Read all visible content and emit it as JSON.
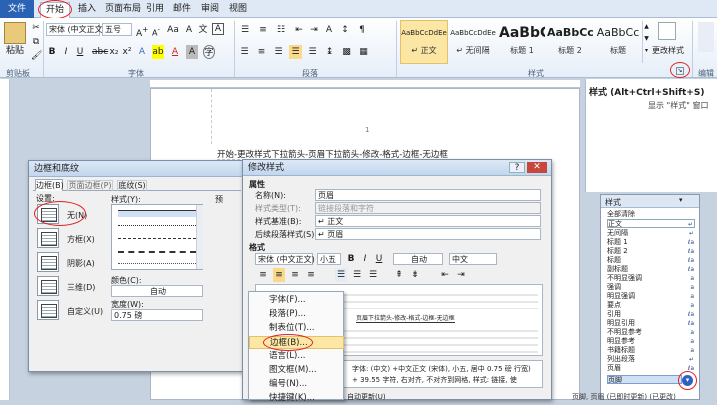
{
  "ribbon": {
    "tabs": [
      "文件",
      "开始",
      "插入",
      "页面布局",
      "引用",
      "邮件",
      "审阅",
      "视图"
    ],
    "clipboard": {
      "paste_label": "粘贴",
      "group_label": "剪贴板"
    },
    "font": {
      "font_name": "宋体 (中文正文)",
      "font_size": "五号",
      "group_label": "字体"
    },
    "paragraph": {
      "group_label": "段落"
    },
    "styles": {
      "items": [
        {
          "preview": "AaBbCcDdEe",
          "name": "↵ 正文"
        },
        {
          "preview": "AaBbCcDdEe",
          "name": "↵ 无间隔"
        },
        {
          "preview": "AaBbC",
          "name": "标题 1"
        },
        {
          "preview": "AaBbCc",
          "name": "标题 2"
        },
        {
          "preview": "AaBbCc",
          "name": "标题"
        }
      ],
      "change_styles_label": "更改样式",
      "group_label": "样式",
      "edit_label": "编辑"
    }
  },
  "document": {
    "page_number": "1",
    "body_text": "开始-更改样式下拉箭头-页眉下拉箭头-修改-格式-边框-无边框"
  },
  "border_dialog": {
    "title": "边框和底纹",
    "tabs": [
      "边框(B)",
      "页面边框(P)",
      "底纹(S)"
    ],
    "setting_label": "设置:",
    "settings": [
      "无(N)",
      "方框(X)",
      "阴影(A)",
      "三维(D)",
      "自定义(U)"
    ],
    "style_label": "样式(Y):",
    "color_label": "颜色(C):",
    "color_value": "自动",
    "width_label": "宽度(W):",
    "width_value": "0.75 磅",
    "preview_label": "预"
  },
  "modify_dialog": {
    "title": "修改样式",
    "properties_label": "属性",
    "name_label": "名称(N):",
    "name_value": "页眉",
    "type_label": "样式类型(T):",
    "type_value": "链接段落和字符",
    "base_label": "样式基准(B):",
    "base_value": "↵ 正文",
    "next_label": "后续段落样式(S):",
    "next_value": "↵ 页眉",
    "format_label": "格式",
    "font_value": "宋体 (中文正文)",
    "size_value": "小五",
    "color_value": "自动",
    "lang_value": "中文",
    "sample_text": "页眉下拉箭头-修改-格式-边框-无边框",
    "desc_line1": "字体: (中文) +中文正文 (宋体), 小五, 居中  0.75 磅 行宽)",
    "desc_line2": "+ 39.55 字符, 右对齐, 不对齐到网格, 样式: 链接, 使",
    "auto_update_label": "自动更新(U)",
    "help_label": "?",
    "close_label": "✕"
  },
  "format_menu": {
    "items": [
      "字体(F)...",
      "段落(P)...",
      "制表位(T)...",
      "边框(B)...",
      "语言(L)...",
      "图文框(M)...",
      "编号(N)...",
      "快捷键(K)..."
    ]
  },
  "styles_pane": {
    "title": "样式 (Alt+Ctrl+Shift+S)",
    "hint": "显示 \"样式\" 窗口",
    "close_label": "✕"
  },
  "styles_list": {
    "title": "样式",
    "items": [
      "全部清除",
      "正文",
      "无间隔",
      "标题 1",
      "标题 2",
      "标题",
      "副标题",
      "不明显强调",
      "强调",
      "明显强调",
      "要点",
      "引用",
      "明显引用",
      "不明显参考",
      "明显参考",
      "书籍标题",
      "列出段落",
      "页眉"
    ],
    "footer": "页脚"
  },
  "status_bar": {
    "text": "页脚, 页眉 (已即时更新) (已更改)"
  },
  "colors": {
    "accent": "#2a62b4",
    "highlight": "#d22222"
  }
}
